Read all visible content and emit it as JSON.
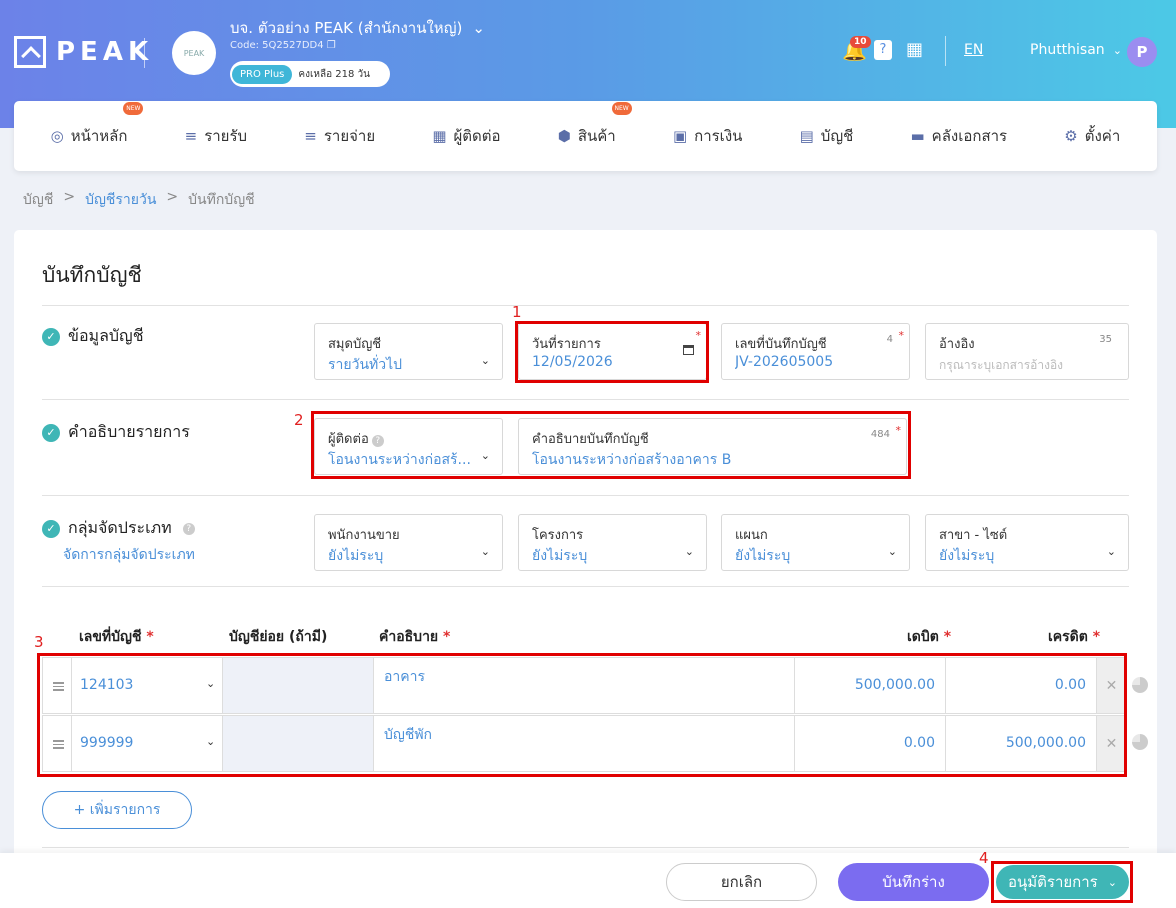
{
  "header": {
    "logo": "PEAK",
    "company_name": "บจ. ตัวอย่าง PEAK (สำนักงานใหญ่)",
    "company_code": "Code: 5Q2527DD4",
    "plan": "PRO Plus",
    "days_left": "คงเหลือ 218 วัน",
    "notif_count": "10",
    "lang": "EN",
    "user": "Phutthisan",
    "avatar": "P",
    "logo_small": "PEAK"
  },
  "nav": [
    "หน้าหลัก",
    "รายรับ",
    "รายจ่าย",
    "ผู้ติดต่อ",
    "สินค้า",
    "การเงิน",
    "บัญชี",
    "คลังเอกสาร",
    "ตั้งค่า"
  ],
  "new_badge": "NEW",
  "breadcrumb": {
    "a": "บัญชี",
    "b": "บัญชีรายวัน",
    "c": "บันทึกบัญชี",
    "sep": ">"
  },
  "page_title": "บันทึกบัญชี",
  "sections": {
    "account_info": "ข้อมูลบัญชี",
    "description": "คำอธิบายรายการ",
    "grouping": "กลุ่มจัดประเภท",
    "grouping_link": "จัดการกลุ่มจัดประเภท"
  },
  "fields": {
    "journal": {
      "label": "สมุดบัญชี",
      "value": "รายวันทั่วไป"
    },
    "date": {
      "label": "วันที่รายการ",
      "value": "12/05/2026"
    },
    "doc_no": {
      "label": "เลขที่บันทึกบัญชี",
      "value": "JV-202605005",
      "count": "4"
    },
    "ref": {
      "label": "อ้างอิง",
      "placeholder": "กรุณาระบุเอกสารอ้างอิง",
      "count": "35"
    },
    "contact": {
      "label": "ผู้ติดต่อ",
      "value": "โอนงานระหว่างก่อสร้..."
    },
    "memo": {
      "label": "คำอธิบายบันทึกบัญชี",
      "value": "โอนงานระหว่างก่อสร้างอาคาร B",
      "count": "484"
    },
    "sales": {
      "label": "พนักงานขาย",
      "value": "ยังไม่ระบุ"
    },
    "project": {
      "label": "โครงการ",
      "value": "ยังไม่ระบุ"
    },
    "dept": {
      "label": "แผนก",
      "value": "ยังไม่ระบุ"
    },
    "branch": {
      "label": "สาขา - ไซต์",
      "value": "ยังไม่ระบุ"
    }
  },
  "table": {
    "h_account": "เลขที่บัญชี",
    "h_sub": "บัญชีย่อย (ถ้ามี)",
    "h_desc": "คำอธิบาย",
    "h_debit": "เดบิต",
    "h_credit": "เครดิต",
    "rows": [
      {
        "account": "124103",
        "desc": "อาคาร",
        "debit": "500,000.00",
        "credit": "0.00"
      },
      {
        "account": "999999",
        "desc": "บัญชีพัก",
        "debit": "0.00",
        "credit": "500,000.00"
      }
    ]
  },
  "add_row": "+ เพิ่มรายการ",
  "footer": {
    "cancel": "ยกเลิก",
    "draft": "บันทึกร่าง",
    "approve": "อนุมัติรายการ"
  },
  "annotations": [
    "1",
    "2",
    "3",
    "4"
  ],
  "colors": {
    "accent": "#4a8fd8",
    "teal": "#3fb6b6",
    "purple": "#7b6cf0",
    "highlight": "#e00000"
  }
}
